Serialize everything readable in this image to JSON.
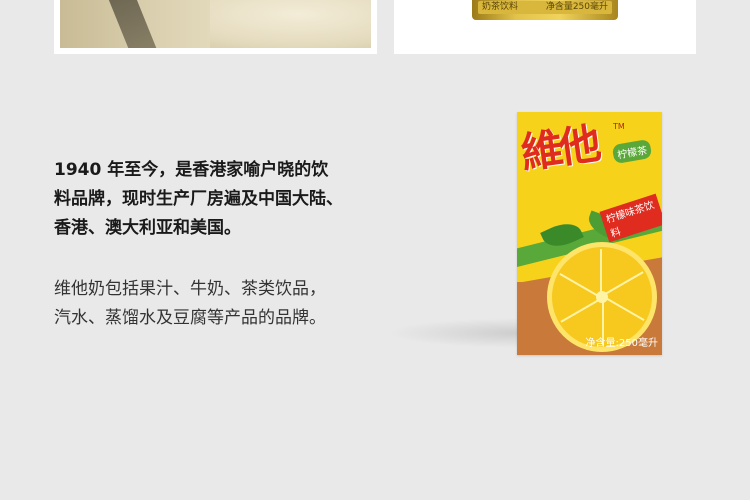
{
  "photos": {
    "left": {
      "icon": "tea-pouring-photo"
    },
    "right": {
      "icon": "gold-pack-photo",
      "label_left": "奶茶饮料",
      "label_right": "净含量250毫升"
    }
  },
  "intro": {
    "line1": "1940 年至今，是香港家喻户晓的饮",
    "line2": "料品牌，现时生产厂房遍及中国大陆、",
    "line3": "香港、澳大利亚和美国。"
  },
  "desc": {
    "line1": "维他奶包括果汁、牛奶、茶类饮品，",
    "line2": "汽水、蒸馏水及豆腐等产品的品牌。"
  },
  "product": {
    "logo": "維他",
    "tm": "TM",
    "flavor_tag": "柠檬茶",
    "flavor_full": "柠檬味茶饮料",
    "net": "净含量:250毫升",
    "colors": {
      "yellow": "#f6d21b",
      "red": "#e02b1f",
      "green": "#58a83a",
      "brown": "#c97a3a"
    }
  }
}
